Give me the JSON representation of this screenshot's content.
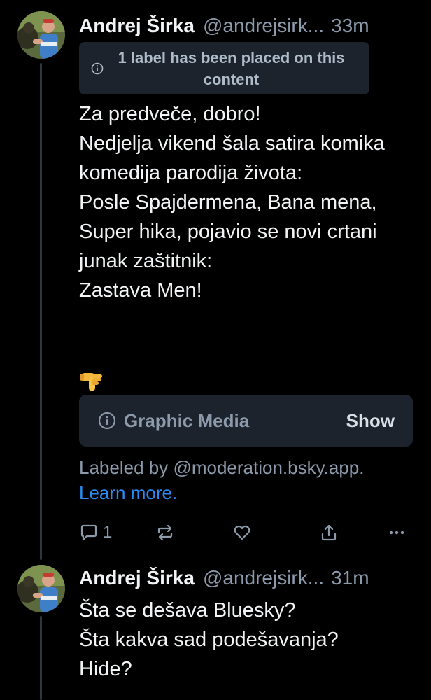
{
  "posts": [
    {
      "author_name": "Andrej Širka",
      "handle": "@andrejsirk...",
      "time": "33m",
      "label_notice": "1 label has been placed on this content",
      "text": "Za predveče, dobro!\nNedjelja vikend šala satira komika komedija parodija života:\nPosle Spajdermena, Bana mena, Super hika, pojavio se novi crtani junak zaštitnik:\nZastava Men!",
      "emoji": "backhand-index-pointing-down",
      "media_warning": {
        "label": "Graphic Media",
        "action": "Show"
      },
      "labeled_by": "Labeled by @moderation.bsky.app.",
      "learn_more": "Learn more.",
      "actions": {
        "reply_count": "1"
      }
    },
    {
      "author_name": "Andrej Širka",
      "handle": "@andrejsirk...",
      "time": "31m",
      "text": "Šta se dešava Bluesky?\nŠta kakva sad podešavanja?\nHide?"
    }
  ],
  "colors": {
    "background": "#000000",
    "text": "#f1f3f5",
    "muted": "#8c9aab",
    "card": "#1c232c",
    "link": "#2a8bf5"
  },
  "icons": [
    "info-icon",
    "reply-icon",
    "repost-icon",
    "like-icon",
    "share-icon",
    "more-icon"
  ]
}
